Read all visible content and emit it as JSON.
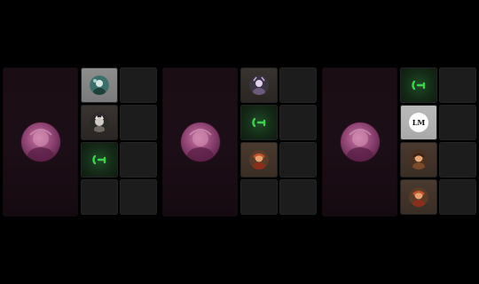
{
  "panels": [
    {
      "id": "panel-1",
      "main_participant": {
        "avatar": "pink-portrait"
      },
      "tiles": [
        {
          "style": "lightgray",
          "content": "avatar",
          "avatar": "teal-portrait"
        },
        {
          "style": "dark",
          "content": "avatar",
          "avatar": "dog-portrait"
        },
        {
          "style": "green",
          "content": "mic-icon"
        },
        {
          "style": "empty"
        }
      ]
    },
    {
      "id": "panel-2",
      "main_participant": {
        "avatar": "pink-portrait"
      },
      "tiles": [
        {
          "style": "dark",
          "content": "avatar",
          "avatar": "lavender-portrait"
        },
        {
          "style": "green",
          "content": "mic-icon"
        },
        {
          "style": "brown",
          "content": "avatar",
          "avatar": "orange-portrait"
        },
        {
          "style": "empty"
        }
      ]
    },
    {
      "id": "panel-3",
      "main_participant": {
        "avatar": "pink-portrait"
      },
      "tiles": [
        {
          "style": "green",
          "content": "mic-icon"
        },
        {
          "style": "bright",
          "content": "logo",
          "logo_text": "LM"
        },
        {
          "style": "brown",
          "content": "avatar",
          "avatar": "orange-portrait"
        },
        {
          "style": "brown",
          "content": "avatar",
          "avatar": "orange-portrait"
        }
      ]
    }
  ],
  "colors": {
    "background": "#000000",
    "panel": "#1a0d14",
    "slot": "#1c1c1c",
    "active_green": "#3fd04e",
    "avatar_pink": "#9c4e7e"
  }
}
